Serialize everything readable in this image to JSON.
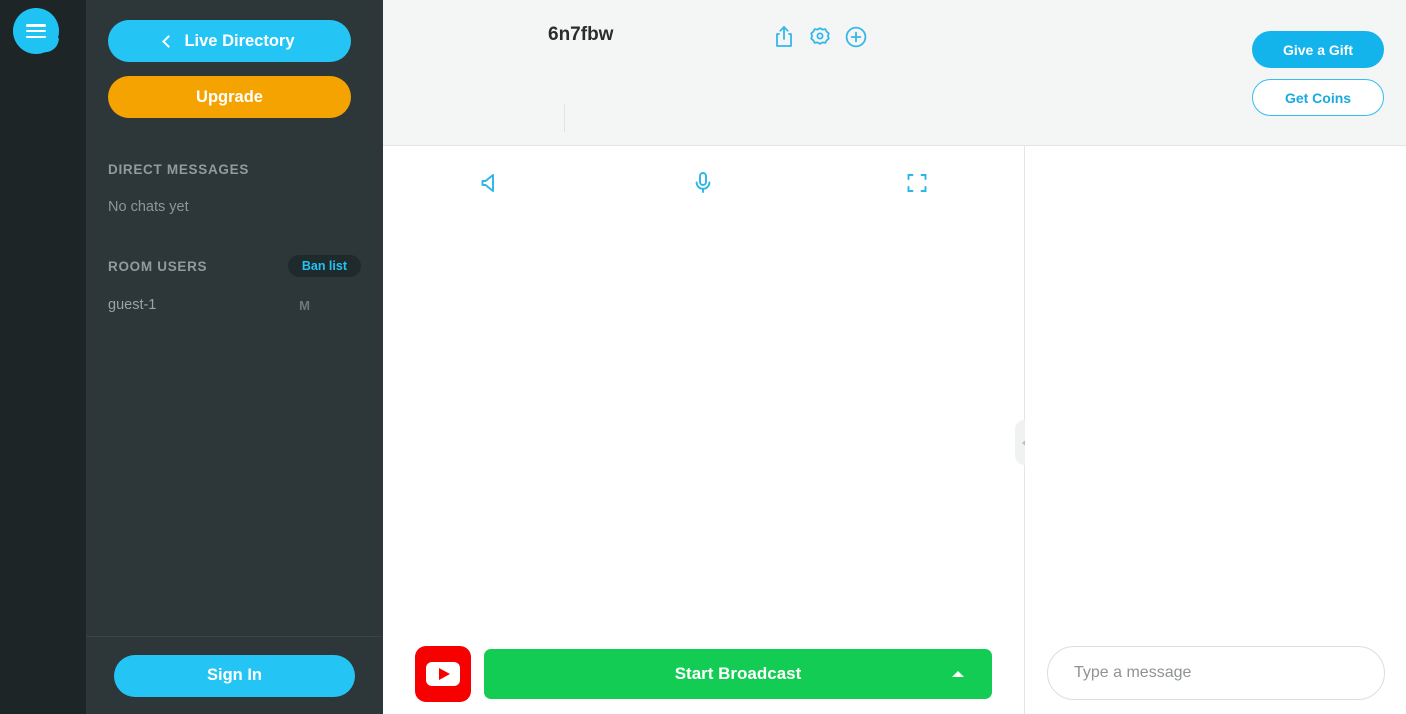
{
  "rail": {
    "menu_icon": "hamburger-chat-bubble-icon"
  },
  "sidebar": {
    "live_directory_label": "Live Directory",
    "upgrade_label": "Upgrade",
    "direct_messages": {
      "title": "DIRECT MESSAGES",
      "empty": "No chats yet"
    },
    "room_users": {
      "title": "ROOM USERS",
      "ban_list_label": "Ban list",
      "users": [
        {
          "name": "guest-1",
          "badge": "M"
        }
      ]
    },
    "sign_in_label": "Sign In"
  },
  "header": {
    "room_title": "6n7fbw",
    "icons": [
      "share-icon",
      "gear-icon",
      "plus-circle-icon"
    ],
    "give_gift_label": "Give a Gift",
    "get_coins_label": "Get Coins"
  },
  "stage": {
    "controls": [
      "speaker-icon",
      "microphone-icon",
      "fullscreen-icon"
    ],
    "youtube_label": "youtube-icon",
    "start_broadcast_label": "Start Broadcast"
  },
  "chat": {
    "input_value": "",
    "input_placeholder": "Type a message"
  },
  "colors": {
    "cyan": "#24c5f4",
    "orange": "#f5a300",
    "green": "#13cc53",
    "youtube_red": "#f60000",
    "sidebar_bg": "#2d3739",
    "rail_bg": "#1e2527"
  }
}
